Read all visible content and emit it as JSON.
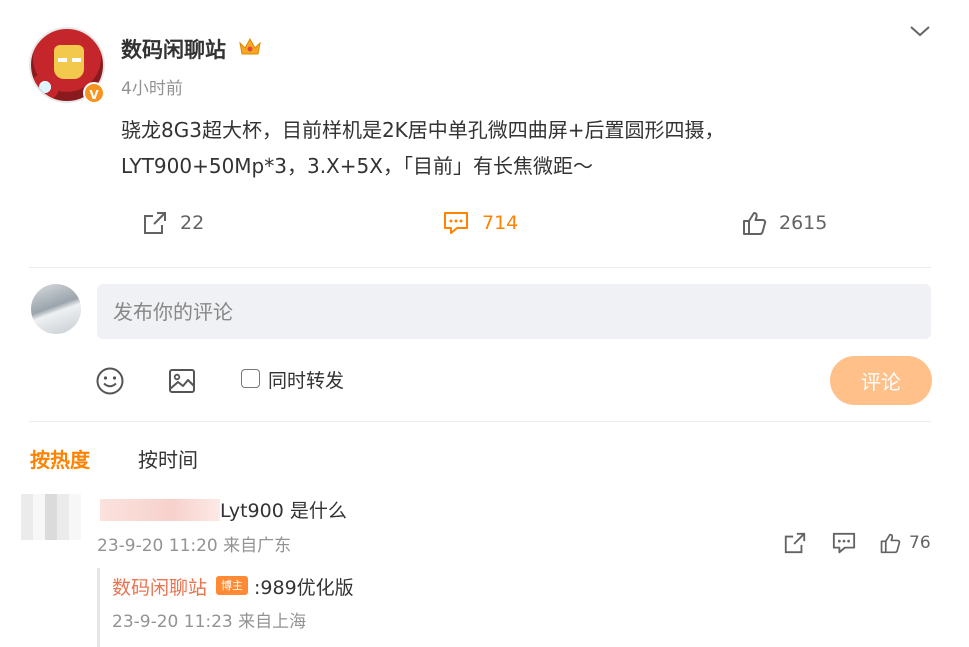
{
  "post": {
    "author": "数码闲聊站",
    "time": "4小时前",
    "verified_badge": "V",
    "text_line1": "骁龙8G3超大杯，目前样机是2K居中单孔微四曲屏+后置圆形四摄，",
    "text_line2": "LYT900+50Mp*3，3.X+5X，「目前」有长焦微距～",
    "reposts": "22",
    "comments": "714",
    "likes": "2615"
  },
  "composer": {
    "placeholder": "发布你的评论",
    "repost_label": "同时转发",
    "submit_label": "评论"
  },
  "sort": {
    "hot_label": "按热度",
    "time_label": "按时间"
  },
  "comment": {
    "text": "Lyt900 是什么",
    "meta": "23-9-20 11:20 来自广东",
    "likes": "76",
    "reply": {
      "author": "数码闲聊站",
      "badge": "博主",
      "text": ":989优化版",
      "meta": "23-9-20 11:23 来自上海"
    }
  },
  "colors": {
    "accent": "#ff8200",
    "reply_name": "#eb7350",
    "submit_disabled": "#ffc08a"
  }
}
